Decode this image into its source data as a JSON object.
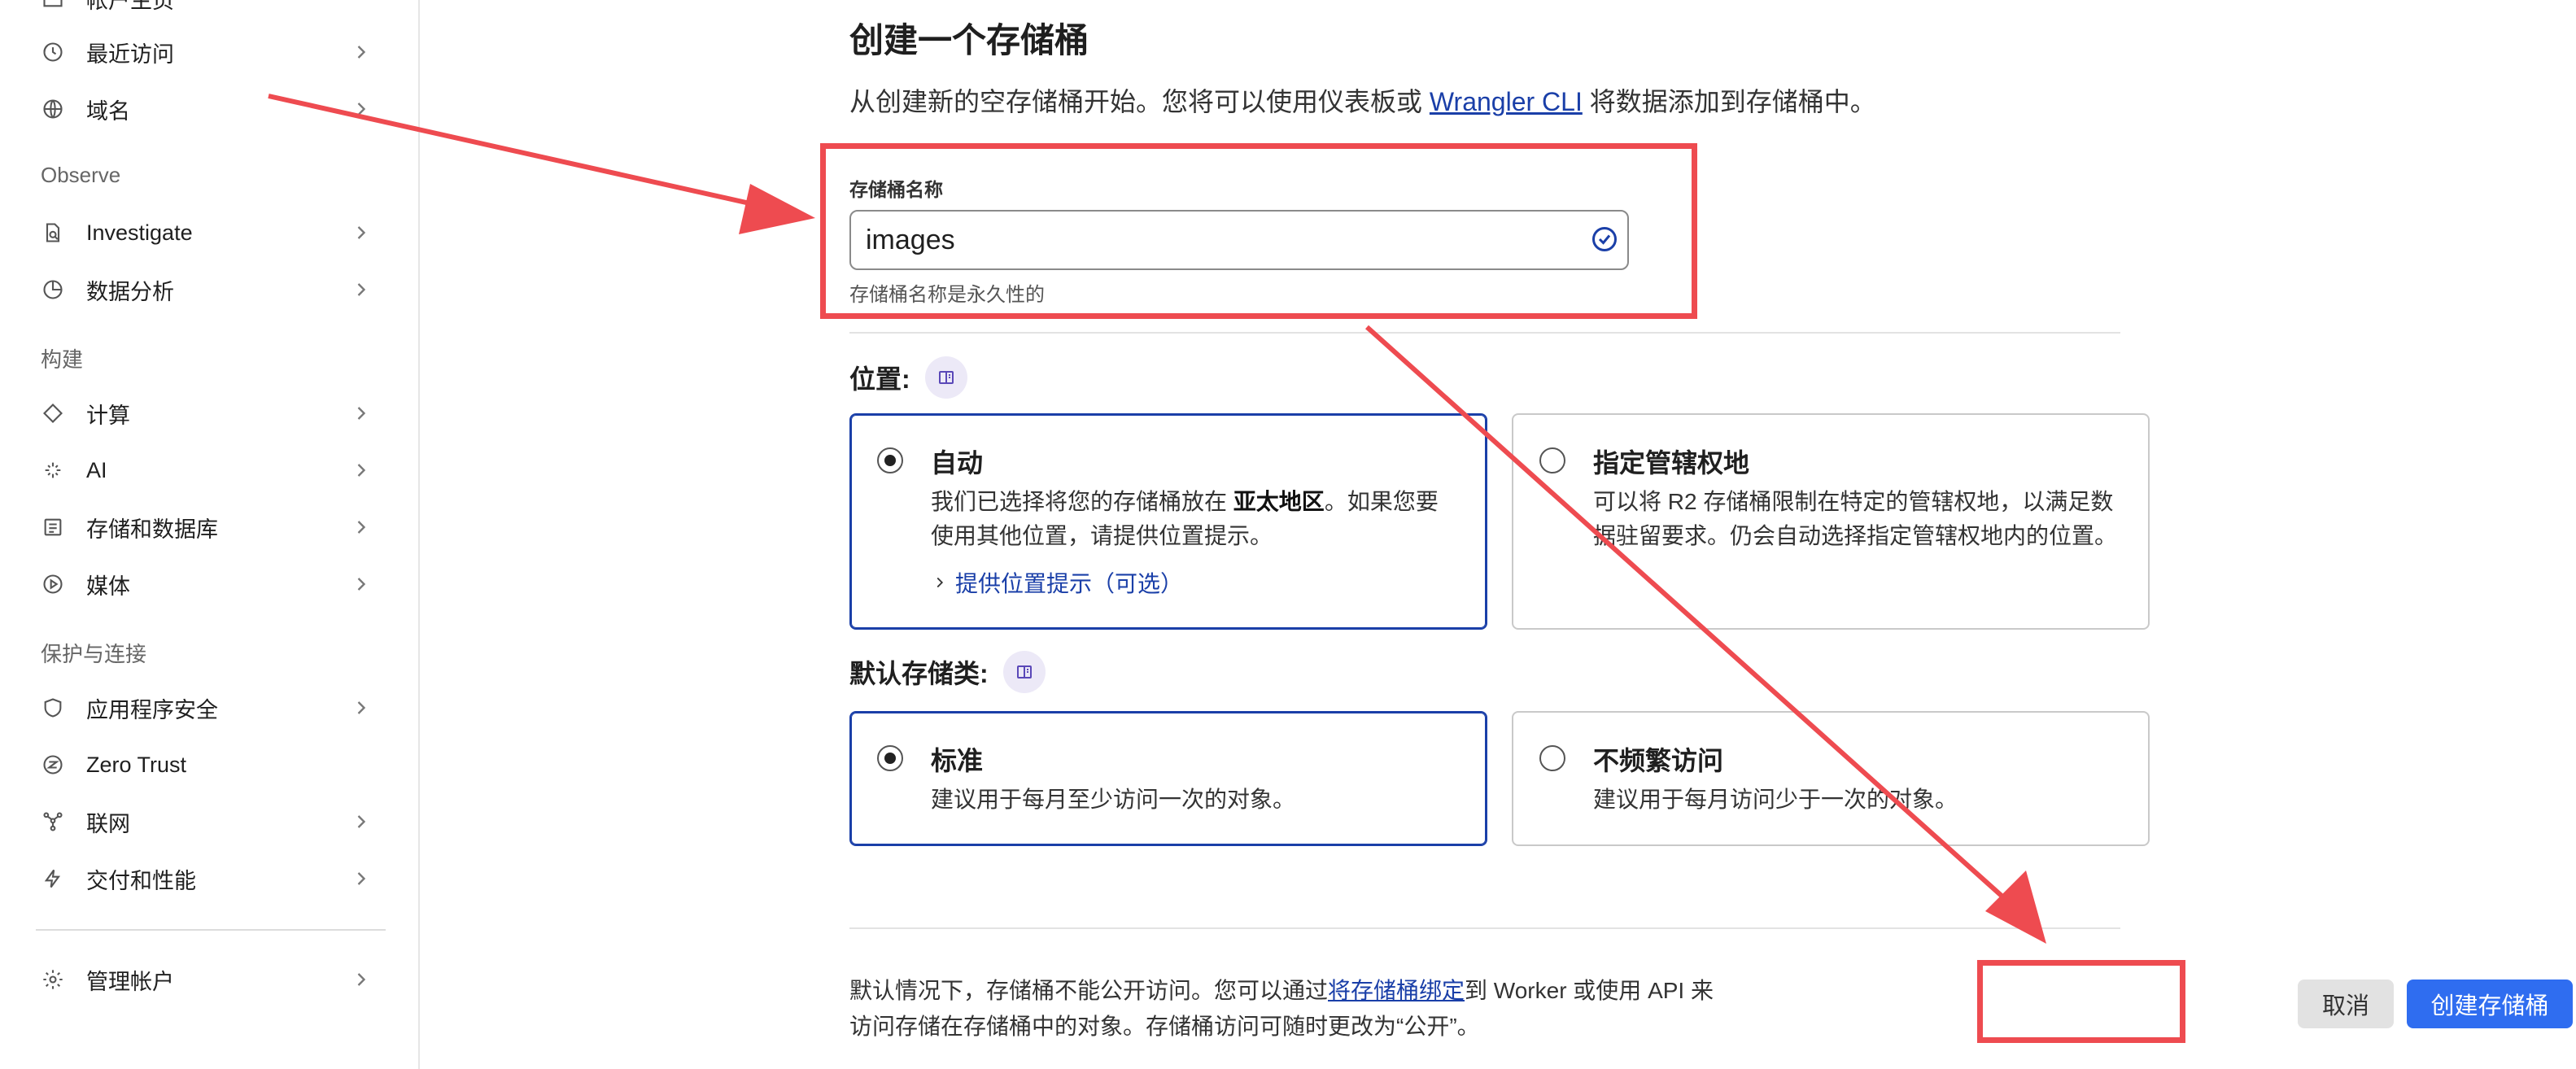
{
  "sidebar": {
    "partial_top_item": {
      "label": "帐户主页"
    },
    "items_top": [
      {
        "label": "最近访问",
        "icon": "clock-icon"
      },
      {
        "label": "域名",
        "icon": "globe-icon"
      }
    ],
    "observe": {
      "title": "Observe",
      "items": [
        {
          "label": "Investigate",
          "icon": "document-search-icon"
        },
        {
          "label": "数据分析",
          "icon": "pie-chart-icon"
        }
      ]
    },
    "build": {
      "title": "构建",
      "items": [
        {
          "label": "计算",
          "icon": "diamond-code-icon"
        },
        {
          "label": "AI",
          "icon": "sparkle-icon"
        },
        {
          "label": "存储和数据库",
          "icon": "storage-icon"
        },
        {
          "label": "媒体",
          "icon": "play-circle-icon"
        }
      ]
    },
    "protect": {
      "title": "保护与连接",
      "items": [
        {
          "label": "应用程序安全",
          "icon": "shield-icon"
        },
        {
          "label": "Zero Trust",
          "icon": "zero-trust-icon"
        },
        {
          "label": "联网",
          "icon": "network-icon"
        },
        {
          "label": "交付和性能",
          "icon": "lightning-icon"
        }
      ]
    },
    "manage": {
      "label": "管理帐户",
      "icon": "gear-icon"
    }
  },
  "main": {
    "title": "创建一个存储桶",
    "description_before": "从创建新的空存储桶开始。您将可以使用仪表板或",
    "description_link": "Wrangler CLI",
    "description_after": "将数据添加到存储桶中。",
    "name_field": {
      "label": "存储桶名称",
      "value": "images",
      "help": "存储桶名称是永久性的"
    },
    "location": {
      "label": "位置:",
      "options": [
        {
          "title": "自动",
          "desc_before": "我们已选择将您的存储桶放在",
          "desc_bold": "亚太地区",
          "desc_after": "。如果您要使用其他位置，请提供位置提示。",
          "link": "提供位置提示（可选）",
          "selected": true
        },
        {
          "title": "指定管辖权地",
          "desc": "可以将 R2 存储桶限制在特定的管辖权地，以满足数据驻留要求。仍会自动选择指定管辖权地内的位置。",
          "selected": false
        }
      ]
    },
    "storage_class": {
      "label": "默认存储类:",
      "options": [
        {
          "title": "标准",
          "desc": "建议用于每月至少访问一次的对象。",
          "selected": true
        },
        {
          "title": "不频繁访问",
          "desc": "建议用于每月访问少于一次的对象。",
          "selected": false
        }
      ]
    },
    "footer": {
      "note_before": "默认情况下，存储桶不能公开访问。您可以通过",
      "note_link": "将存储桶绑定",
      "note_after": "到 Worker 或使用 API 来访问存储在存储桶中的对象。存储桶访问可随时更改为“公开”。",
      "cancel_label": "取消",
      "create_label": "创建存储桶"
    }
  },
  "colors": {
    "accent": "#2f6df0",
    "link": "#1a3fa8",
    "annotation": "#ee4b50"
  }
}
